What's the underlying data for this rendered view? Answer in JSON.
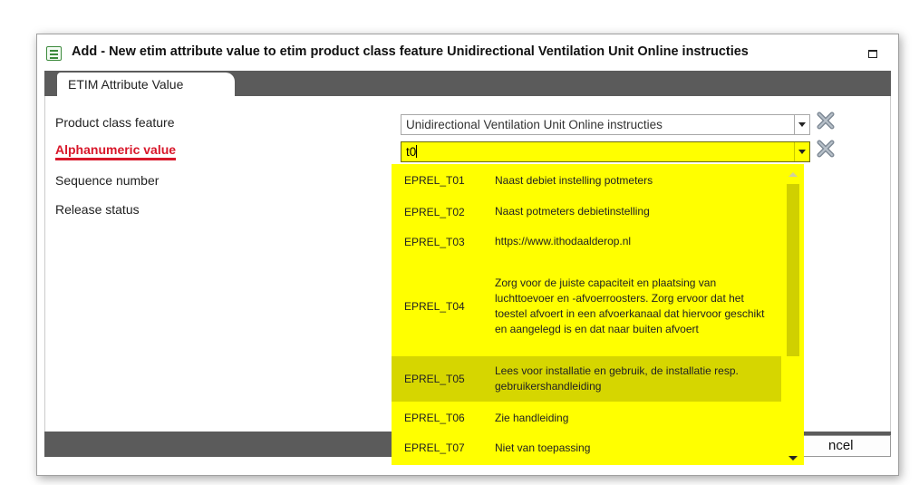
{
  "dialog": {
    "title": "Add - New etim attribute value to etim product class feature Unidirectional Ventilation Unit Online instructies",
    "tab_label": "ETIM Attribute Value",
    "cancel_label": "ncel"
  },
  "form": {
    "product_class_feature": {
      "label": "Product class feature",
      "value": "Unidirectional Ventilation Unit Online instructies"
    },
    "alphanumeric_value": {
      "label": "Alphanumeric value",
      "value": "t0",
      "required": true
    },
    "sequence_number": {
      "label": "Sequence number"
    },
    "release_status": {
      "label": "Release status"
    }
  },
  "dropdown": {
    "highlighted_index": 4,
    "options": [
      {
        "code": "EPREL_T01",
        "description": "Naast debiet instelling potmeters"
      },
      {
        "code": "EPREL_T02",
        "description": "Naast potmeters debietinstelling"
      },
      {
        "code": "EPREL_T03",
        "description": "https://www.ithodaalderop.nl"
      },
      {
        "code": "EPREL_T04",
        "description": "Zorg voor de juiste capaciteit en plaatsing van luchttoevoer en -afvoerroosters. Zorg ervoor dat het toestel afvoert in een afvoerkanaal dat hiervoor geschikt en aangelegd is en dat naar buiten afvoert"
      },
      {
        "code": "EPREL_T05",
        "description": "Lees voor installatie en gebruik, de installatie resp. gebruikershandleiding"
      },
      {
        "code": "EPREL_T06",
        "description": "Zie handleiding"
      },
      {
        "code": "EPREL_T07",
        "description": "Niet van toepassing"
      }
    ]
  },
  "colors": {
    "highlight": "#ffff00",
    "highlight_selected": "#d6d600",
    "required": "#d8172a",
    "bar": "#5b5b5b"
  },
  "icons": {
    "window": "form-window-icon",
    "maximize": "maximize-icon",
    "clear": "clear-x-icon",
    "dropdown": "chevron-down-icon"
  }
}
